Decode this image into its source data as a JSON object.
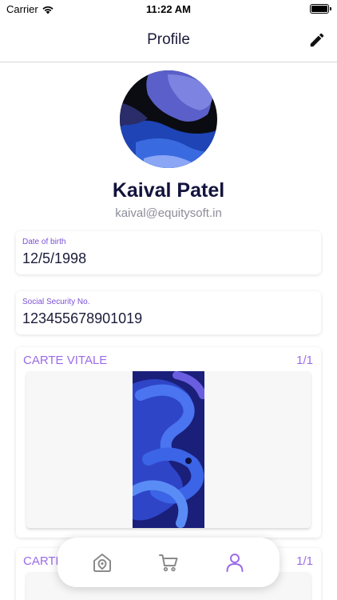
{
  "status_bar": {
    "carrier": "Carrier",
    "time": "11:22 AM",
    "icons": [
      "wifi-icon",
      "battery-icon"
    ]
  },
  "header": {
    "title": "Profile",
    "edit_icon": "pencil-icon"
  },
  "profile": {
    "name": "Kaival Patel",
    "email": "kaival@equitysoft.in"
  },
  "fields": [
    {
      "label": "Date of birth",
      "value": "12/5/1998"
    },
    {
      "label": "Social Security No.",
      "value": "123455678901019"
    }
  ],
  "documents": [
    {
      "title": "CARTE VITALE",
      "count": "1/1"
    },
    {
      "title": "CARTE",
      "count": "1/1"
    }
  ],
  "tab_bar": {
    "tabs": [
      {
        "icon": "home-icon",
        "active": false
      },
      {
        "icon": "cart-icon",
        "active": false
      },
      {
        "icon": "profile-icon",
        "active": true
      }
    ],
    "active_color": "#9b6be8",
    "inactive_color": "#8a8a8a"
  },
  "colors": {
    "accent": "#9b6be8",
    "label": "#7b4fd6",
    "name": "#13133d",
    "email": "#8d8d99"
  }
}
